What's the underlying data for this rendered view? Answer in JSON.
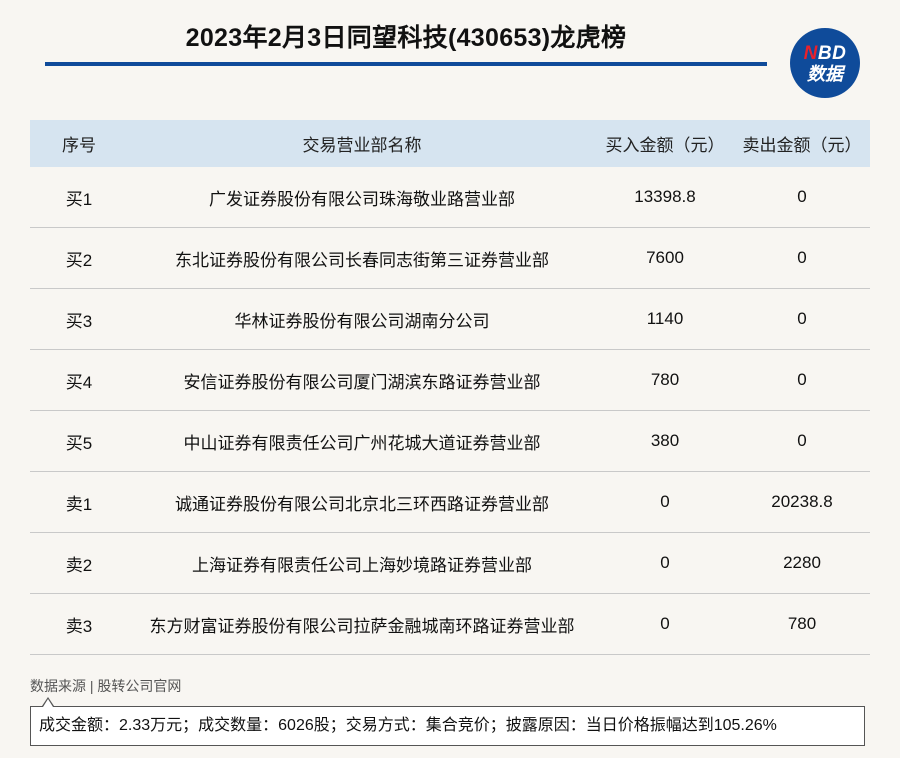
{
  "header": {
    "title": "2023年2月3日同望科技(430653)龙虎榜"
  },
  "logo": {
    "line1_accent": "N",
    "line1_rest": "BD",
    "line2": "数据"
  },
  "table": {
    "columns": [
      "序号",
      "交易营业部名称",
      "买入金额（元）",
      "卖出金额（元）"
    ],
    "rows": [
      {
        "seq": "买1",
        "name": "广发证券股份有限公司珠海敬业路营业部",
        "buy": "13398.8",
        "sell": "0"
      },
      {
        "seq": "买2",
        "name": "东北证券股份有限公司长春同志街第三证券营业部",
        "buy": "7600",
        "sell": "0"
      },
      {
        "seq": "买3",
        "name": "华林证券股份有限公司湖南分公司",
        "buy": "1140",
        "sell": "0"
      },
      {
        "seq": "买4",
        "name": "安信证券股份有限公司厦门湖滨东路证券营业部",
        "buy": "780",
        "sell": "0"
      },
      {
        "seq": "买5",
        "name": "中山证券有限责任公司广州花城大道证券营业部",
        "buy": "380",
        "sell": "0"
      },
      {
        "seq": "卖1",
        "name": "诚通证券股份有限公司北京北三环西路证券营业部",
        "buy": "0",
        "sell": "20238.8"
      },
      {
        "seq": "卖2",
        "name": "上海证券有限责任公司上海妙境路证券营业部",
        "buy": "0",
        "sell": "2280"
      },
      {
        "seq": "卖3",
        "name": "东方财富证券股份有限公司拉萨金融城南环路证券营业部",
        "buy": "0",
        "sell": "780"
      }
    ]
  },
  "footer": {
    "source": "数据来源 | 股转公司官网",
    "summary": "成交金额：2.33万元；成交数量：6026股；交易方式：集合竞价；披露原因：当日价格振幅达到105.26%"
  },
  "colors": {
    "brand_blue": "#0f4b9a",
    "brand_red": "#e8212b",
    "header_bg": "#d6e4f0"
  }
}
